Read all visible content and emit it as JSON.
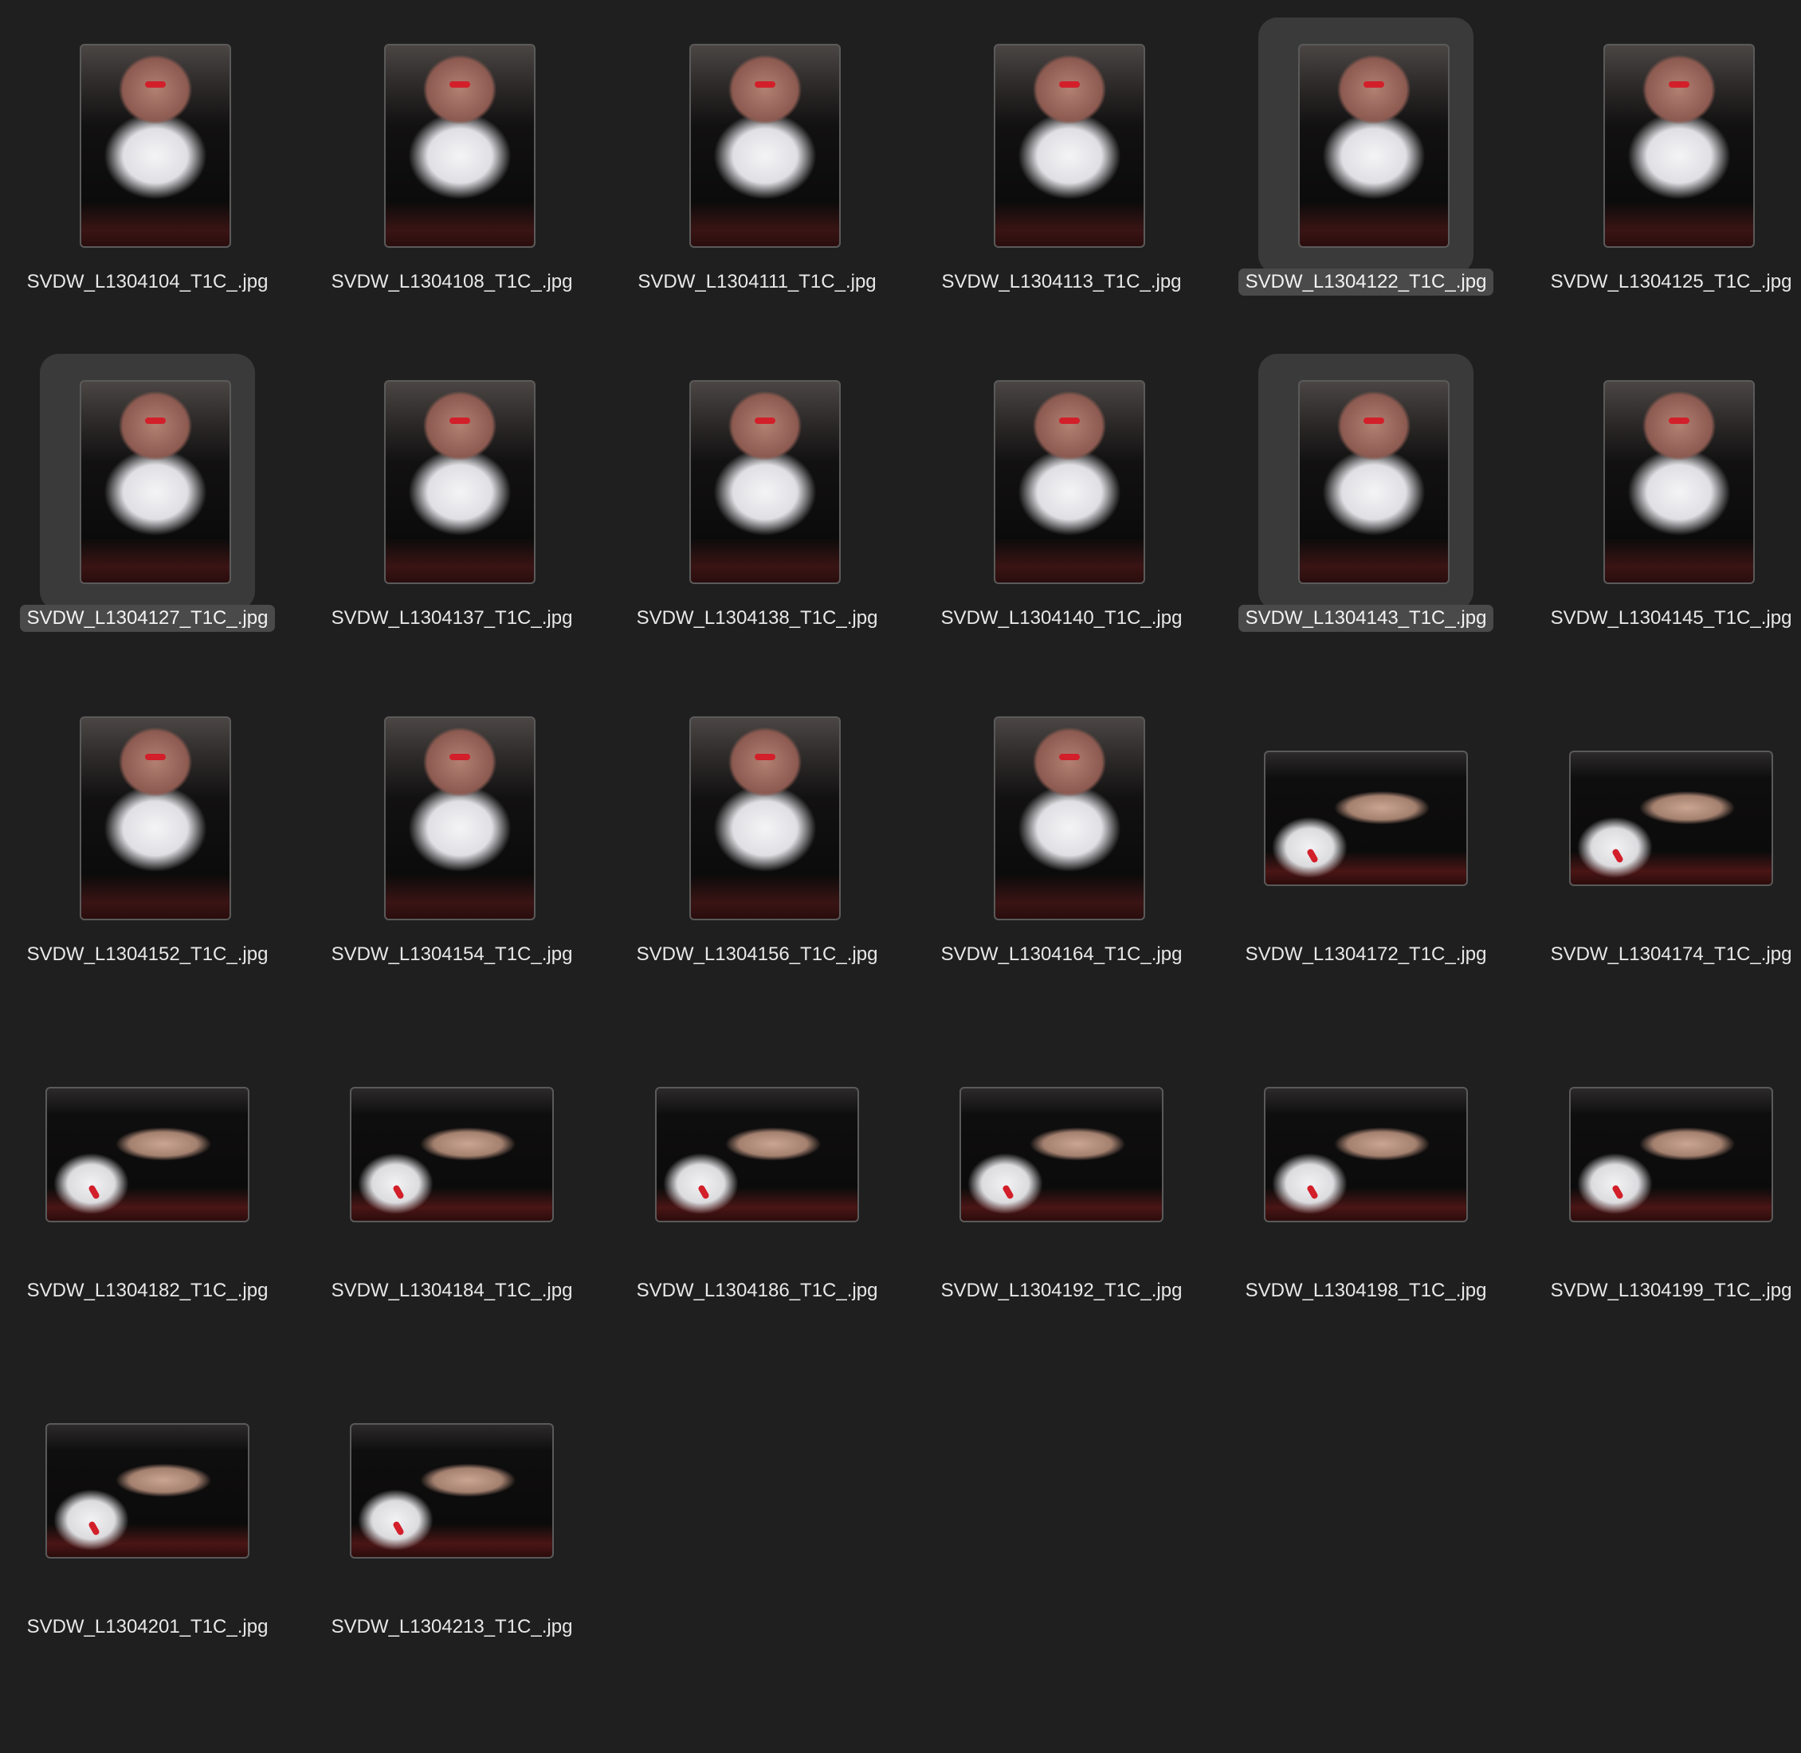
{
  "file_grid": {
    "items": [
      {
        "name": "SVDW_L1304104_T1C_.jpg",
        "orientation": "portrait",
        "selected": false
      },
      {
        "name": "SVDW_L1304108_T1C_.jpg",
        "orientation": "portrait",
        "selected": false
      },
      {
        "name": "SVDW_L1304111_T1C_.jpg",
        "orientation": "portrait",
        "selected": false
      },
      {
        "name": "SVDW_L1304113_T1C_.jpg",
        "orientation": "portrait",
        "selected": false
      },
      {
        "name": "SVDW_L1304122_T1C_.jpg",
        "orientation": "portrait",
        "selected": true
      },
      {
        "name": "SVDW_L1304125_T1C_.jpg",
        "orientation": "portrait",
        "selected": false
      },
      {
        "name": "SVDW_L1304127_T1C_.jpg",
        "orientation": "portrait",
        "selected": true
      },
      {
        "name": "SVDW_L1304137_T1C_.jpg",
        "orientation": "portrait",
        "selected": false
      },
      {
        "name": "SVDW_L1304138_T1C_.jpg",
        "orientation": "portrait",
        "selected": false
      },
      {
        "name": "SVDW_L1304140_T1C_.jpg",
        "orientation": "portrait",
        "selected": false
      },
      {
        "name": "SVDW_L1304143_T1C_.jpg",
        "orientation": "portrait",
        "selected": true
      },
      {
        "name": "SVDW_L1304145_T1C_.jpg",
        "orientation": "portrait",
        "selected": false
      },
      {
        "name": "SVDW_L1304152_T1C_.jpg",
        "orientation": "portrait",
        "selected": false
      },
      {
        "name": "SVDW_L1304154_T1C_.jpg",
        "orientation": "portrait",
        "selected": false
      },
      {
        "name": "SVDW_L1304156_T1C_.jpg",
        "orientation": "portrait",
        "selected": false
      },
      {
        "name": "SVDW_L1304164_T1C_.jpg",
        "orientation": "portrait",
        "selected": false
      },
      {
        "name": "SVDW_L1304172_T1C_.jpg",
        "orientation": "landscape",
        "selected": false
      },
      {
        "name": "SVDW_L1304174_T1C_.jpg",
        "orientation": "landscape",
        "selected": false
      },
      {
        "name": "SVDW_L1304182_T1C_.jpg",
        "orientation": "landscape",
        "selected": false
      },
      {
        "name": "SVDW_L1304184_T1C_.jpg",
        "orientation": "landscape",
        "selected": false
      },
      {
        "name": "SVDW_L1304186_T1C_.jpg",
        "orientation": "landscape",
        "selected": false
      },
      {
        "name": "SVDW_L1304192_T1C_.jpg",
        "orientation": "landscape",
        "selected": false
      },
      {
        "name": "SVDW_L1304198_T1C_.jpg",
        "orientation": "landscape",
        "selected": false
      },
      {
        "name": "SVDW_L1304199_T1C_.jpg",
        "orientation": "landscape",
        "selected": false
      },
      {
        "name": "SVDW_L1304201_T1C_.jpg",
        "orientation": "landscape",
        "selected": false
      },
      {
        "name": "SVDW_L1304213_T1C_.jpg",
        "orientation": "landscape",
        "selected": false
      }
    ]
  },
  "colors": {
    "background": "#1f1f1f",
    "selection_background": "#3a3a3a",
    "selected_label_background": "#4a4a4a",
    "label_text": "#e8e8e8"
  }
}
